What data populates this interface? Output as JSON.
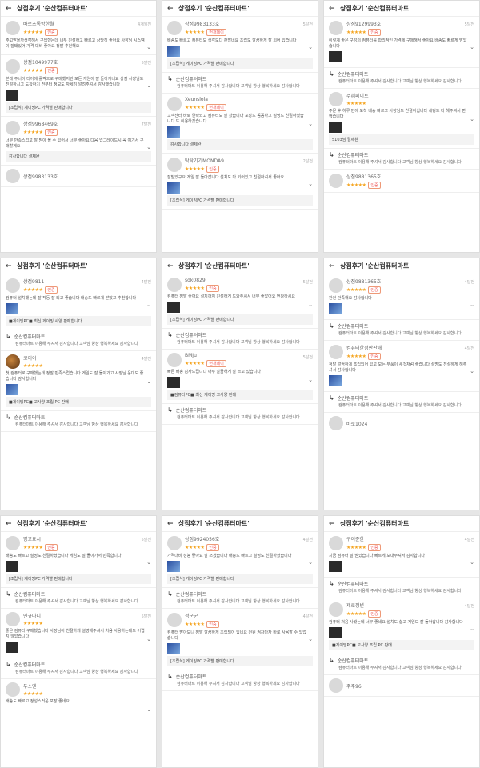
{
  "header_title": "상점후기 '순산컴퓨터마트'",
  "back_glyph": "←",
  "star_glyph": "★★★★★",
  "chevron_glyph": "⌄",
  "reply_arrow_glyph": "↳",
  "colors": {
    "star": "#f5a623",
    "badge": "#e55555",
    "panel_bg": "#ffffff",
    "page_bg": "#e6e6e6"
  },
  "panels": [
    {
      "reviews": [
        {
          "user": "바로초록방한월",
          "badge": "인증",
          "date": "4개월전",
          "text": "주고받을까생각해서 구입했는데 너무 친절하고 빠르고 상당히 좋아요 사장님 시스템이 잘돼있어 가격 대비 좋아요 정말 추천해요",
          "thumb": false,
          "product": ""
        },
        {
          "user": "상점1049977호",
          "badge": "인증",
          "date": "5달전",
          "text": "본래 주니어 티어에 홀짝으로 구매했지만 모든 게임이 잘 돌아가네요 상점 사장님도 친절하시고 도착하기 전부터 정보도 자세히 알려주셔서 감사했습니다",
          "thumb": true,
          "product": "[조립식] 게이밍PC 가격빨 판매합니다"
        },
        {
          "user": "상점9968469호",
          "badge": "인증",
          "date": "7달전",
          "text": "너무 만족스럽고 잘 받아 볼 수 있어서 너무 좋아요 다음 업그레이드시 꼭 여기서 구매할께요",
          "thumb": false,
          "product": "감사합니다 결제완"
        },
        {
          "user": "상점9983133호",
          "badge": "",
          "date": "",
          "text": "",
          "thumb": false,
          "product": ""
        }
      ]
    },
    {
      "reviews": [
        {
          "user": "상점9983133호",
          "badge": "번개페이",
          "date": "5달전",
          "text": "배송도 빠르고 컴퓨터도 생각보다 괜찮네요 조립도 깔끔하게 잘 되어 있습니다",
          "thumb": true,
          "product": "[조립식] 게이밍PC 가격빨 판매합니다",
          "reply": "컴퓨터마트 이용해 주셔서 감사합니다 고객님 항상 행복하세요 감사합니다"
        },
        {
          "user": "Xeunslola",
          "badge": "번개페이",
          "date": "",
          "text": "고객센터 바로 연락되고 컴퓨터도 잘 왔습니다 포장도 꼼꼼하고 설명도 친절하셨습니다 또 이용하겠습니다",
          "thumb": true,
          "product": "감사합니다 결제완"
        },
        {
          "user": "탁탁기기MONDA9",
          "badge": "인증",
          "date": "2달전",
          "text": "잘받았구요 게임 잘 돌아갑니다 설치도 다 되어있고 친절하셔서 좋아요",
          "thumb": true,
          "product": "[조립식] 게이밍PC 가격빨 판매합니다"
        }
      ]
    },
    {
      "reviews": [
        {
          "user": "상점9129993호",
          "badge": "인증",
          "date": "5달전",
          "text": "이렇게 좋은 구성의 컴퓨터를 합리적인 가격에 구매해서 좋아요 배송도 빠르게 받았습니다",
          "thumb": true,
          "product": "",
          "reply": "컴퓨터마트 이용해 주셔서 감사합니다 고객님 항상 행복하세요 감사합니다"
        },
        {
          "user": "주혜페이트",
          "badge": "",
          "date": "",
          "text": "주문 후 하루 만에 도착 배송 빠르고 사장님도 친절하십니다 세팅도 다 해주셔서 편했습니다",
          "thumb": true,
          "product": "5103님 결제완",
          "reply": "컴퓨터마트 이용해 주셔서 감사합니다 고객님 항상 행복하세요 감사합니다"
        },
        {
          "user": "상점9881365호",
          "badge": "인증",
          "date": "",
          "text": "",
          "thumb": false,
          "product": ""
        }
      ]
    },
    {
      "reviews": [
        {
          "user": "상점9811",
          "badge": "인증",
          "date": "4달전",
          "text": "컴퓨터 설치했는데 잘 작동 잘 되고 좋습니다 배송도 빠르게 받았고 추천합니다",
          "thumb": true,
          "product": "■게이밍PC■ 최신 게이밍 사양 판매합니다",
          "reply": "컴퓨터마트 이용해 주셔서 감사합니다 고객님 항상 행복하세요 감사합니다"
        },
        {
          "user": "코어이",
          "badge": "",
          "date": "4달전",
          "text": "첫 컴퓨터로 구매했는데 정말 만족스럽습니다 게임도 잘 돌아가고 사장님 응대도 좋습니다 감사합니다",
          "thumb": true,
          "product": "■게이밍PC■ 고사양 조립 PC 판매",
          "avatar_img": true,
          "reply": "컴퓨터마트 이용해 주셔서 감사합니다 고객님 항상 행복하세요 감사합니다"
        }
      ]
    },
    {
      "reviews": [
        {
          "user": "sdk0829",
          "badge": "인증",
          "date": "5달전",
          "text": "컴퓨터 정말 좋아요 설치까지 친절하게 도와주셔서 너무 좋았어요 번창하세요",
          "thumb": true,
          "product": "[조립식] 게이밍PC 가격빨 판매합니다",
          "reply": "컴퓨터마트 이용해 주셔서 감사합니다 고객님 항상 행복하세요 감사합니다"
        },
        {
          "user": "BMJu",
          "badge": "번개페이",
          "date": "5달전",
          "text": "빠른 배송 감사드립니다 아주 깔끔하게 잘 쓰고 있습니다",
          "thumb": true,
          "product": "■컴퓨터PC■ 최신 게이밍 고사양 판매",
          "reply": "컴퓨터마트 이용해 주셔서 감사합니다 고객님 항상 행복하세요 감사합니다"
        }
      ]
    },
    {
      "reviews": [
        {
          "user": "상점9881365호",
          "badge": "인증",
          "date": "4달전",
          "text": "완전 만족해요 감사합니다",
          "thumb": true,
          "product": "",
          "reply": "컴퓨터마트 이용해 주셔서 감사합니다 고객님 항상 행복하세요 감사합니다"
        },
        {
          "user": "컴퓨터한정판판매",
          "badge": "인증",
          "date": "4달전",
          "text": "정말 깔끔하게 조립되어 있고 모든 부품이 새것처럼 좋습니다 설명도 친절하게 해주셔서 감사합니다",
          "thumb": true,
          "product": "",
          "reply": "컴퓨터마트 이용해 주셔서 감사합니다 고객님 항상 행복하세요 감사합니다"
        },
        {
          "user": "바로1024",
          "badge": "",
          "date": "",
          "text": "",
          "thumb": false,
          "product": ""
        }
      ]
    },
    {
      "reviews": [
        {
          "user": "명고요시",
          "badge": "인증",
          "date": "5달전",
          "text": "배송도 빠르고 설명도 친절하셨습니다 게임도 잘 돌아가서 만족합니다",
          "thumb": true,
          "product": "[조립식] 게이밍PC 가격빨 판매합니다",
          "reply": "컴퓨터마트 이용해 주셔서 감사합니다 고객님 항상 행복하세요 감사합니다"
        },
        {
          "user": "민규나니",
          "badge": "",
          "date": "5달전",
          "text": "좋은 컴퓨터 구매했습니다 사장님이 친절하게 설명해주셔서 처음 사용하는데도 어렵지 않았습니다",
          "thumb": true,
          "product": "",
          "reply": "컴퓨터마트 이용해 주셔서 감사합니다 고객님 항상 행복하세요 감사합니다"
        },
        {
          "user": "두스엔",
          "badge": "",
          "date": "",
          "text": "배송도 빠르고 정성스러운 포장 좋네요",
          "thumb": false,
          "product": ""
        }
      ]
    },
    {
      "reviews": [
        {
          "user": "상점9924056호",
          "badge": "인증",
          "date": "4달전",
          "text": "가격대비 성능 좋아요 잘 쓰겠습니다 배송도 빠르고 설명도 친절하셨습니다",
          "thumb": true,
          "product": "[조립식] 게이밍PC 가격빨 판매합니다",
          "reply": "컴퓨터마트 이용해 주셔서 감사합니다 고객님 항상 행복하세요 감사합니다"
        },
        {
          "user": "정군군",
          "badge": "인증",
          "date": "4달전",
          "text": "컴퓨터 받아보니 정말 깔끔하게 조립되어 있네요 전원 켜자마자 바로 사용할 수 있었습니다",
          "thumb": true,
          "product": "[조립식] 게이밍PC 가격빨 판매합니다",
          "reply": "컴퓨터마트 이용해 주셔서 감사합니다 고객님 항상 행복하세요 감사합니다"
        }
      ]
    },
    {
      "reviews": [
        {
          "user": "구이준한",
          "badge": "인증",
          "date": "4달전",
          "text": "지금 컴퓨터 잘 받았습니다 빠르게 보내주셔서 감사합니다",
          "thumb": true,
          "product": "",
          "reply": "컴퓨터마트 이용해 주셔서 감사합니다 고객님 항상 행복하세요 감사합니다"
        },
        {
          "user": "제로정변",
          "badge": "인증",
          "date": "4달전",
          "text": "컴퓨터 처음 사봤는데 너무 좋네요 설치도 쉽고 게임도 잘 돌아갑니다 감사합니다",
          "thumb": true,
          "product": "■게이밍PC■ 고사양 조립 PC 판매",
          "reply": "컴퓨터마트 이용해 주셔서 감사합니다 고객님 항상 행복하세요 감사합니다"
        },
        {
          "user": "주주96",
          "badge": "",
          "date": "",
          "text": "",
          "thumb": false,
          "product": ""
        }
      ]
    }
  ]
}
